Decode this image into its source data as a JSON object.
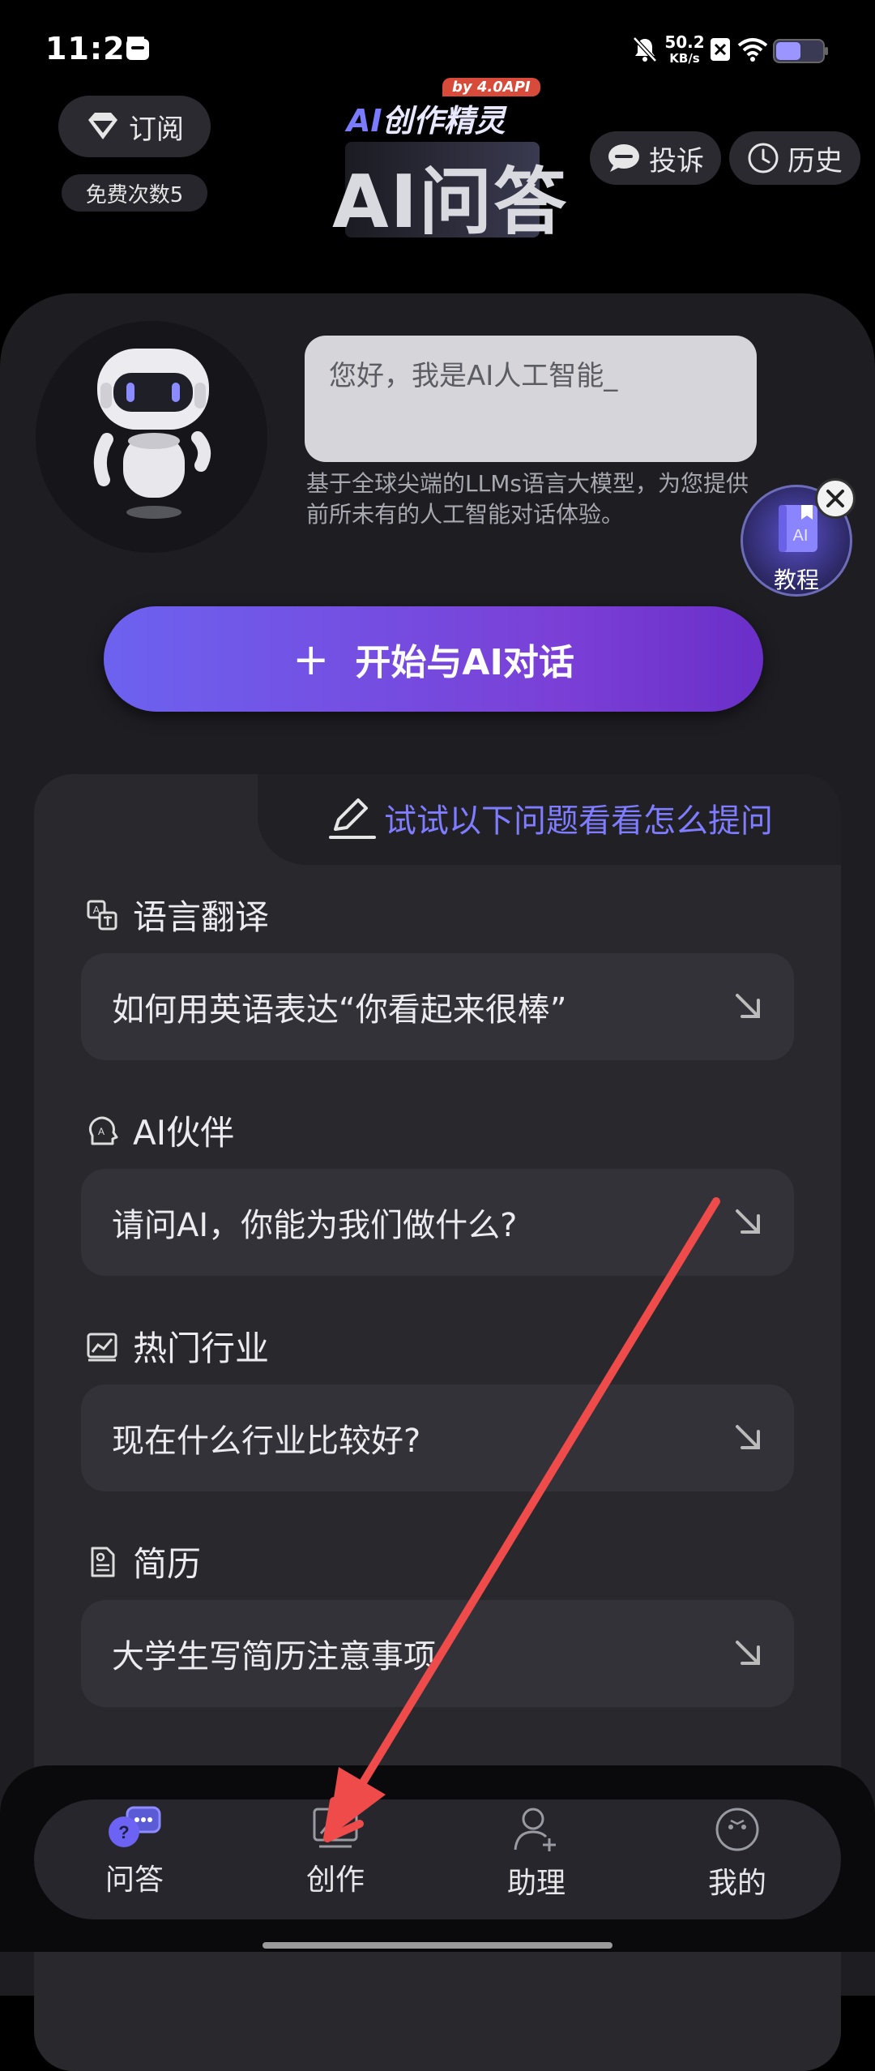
{
  "status": {
    "time": "11:27",
    "net_speed": "50.2",
    "net_unit": "KB/s"
  },
  "header": {
    "subscribe_label": "订阅",
    "free_count": "免费次数5",
    "brand_badge": "by 4.0API",
    "brand_ai": "AI",
    "brand_name": "创作精灵",
    "title": "AI问答",
    "complaint_label": "投诉",
    "history_label": "历史"
  },
  "intro": {
    "greeting": "您好，我是AI人工智能_",
    "description": "基于全球尖端的LLMs语言大模型，为您提供前所未有的人工智能对话体验。",
    "tutorial_label": "教程",
    "tutorial_icon_text": "AI"
  },
  "start_button": {
    "plus": "+",
    "label": "开始与AI对话"
  },
  "suggestions": {
    "hint": "试试以下问题看看怎么提问",
    "categories": [
      {
        "title": "语言翻译",
        "icon": "translate-icon",
        "question": "如何用英语表达“你看起来很棒”"
      },
      {
        "title": "AI伙伴",
        "icon": "ai-partner-icon",
        "question": "请问AI，你能为我们做什么?"
      },
      {
        "title": "热门行业",
        "icon": "trend-chart-icon",
        "question": "现在什么行业比较好?"
      },
      {
        "title": "简历",
        "icon": "resume-icon",
        "question": "大学生写简历注意事项"
      }
    ]
  },
  "nav": {
    "items": [
      {
        "label": "问答",
        "icon": "qa-chat-icon",
        "active": true
      },
      {
        "label": "创作",
        "icon": "create-chart-icon",
        "active": false
      },
      {
        "label": "助理",
        "icon": "assistant-user-icon",
        "active": false
      },
      {
        "label": "我的",
        "icon": "profile-face-icon",
        "active": false
      }
    ]
  },
  "colors": {
    "accent": "#7f7cff",
    "button_gradient_start": "#6d62f0",
    "button_gradient_end": "#6a2fc8",
    "annotation_arrow": "#ef4b4b"
  }
}
